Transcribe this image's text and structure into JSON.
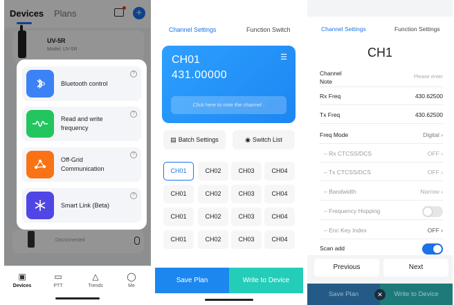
{
  "devices_screen": {
    "tab_devices": "Devices",
    "tab_plans": "Plans",
    "device_name": "UV-5R",
    "device_model": "Model: UV-5R",
    "disconnected": "Disconnected",
    "popup_items": [
      {
        "label": "Bluetooth control",
        "icon": "bluetooth-icon",
        "color": "#3b82f6"
      },
      {
        "label": "Read and write frequency",
        "icon": "waveform-icon",
        "color": "#22c55e"
      },
      {
        "label": "Off-Grid Communication",
        "icon": "network-icon",
        "color": "#f97316"
      },
      {
        "label": "Smart Link (Beta)",
        "icon": "smartlink-icon",
        "color": "#4f46e5"
      }
    ],
    "nav": [
      {
        "label": "Devices",
        "icon": "devices-icon"
      },
      {
        "label": "PTT",
        "icon": "ptt-icon"
      },
      {
        "label": "Trends",
        "icon": "trends-icon"
      },
      {
        "label": "Me",
        "icon": "me-icon"
      }
    ]
  },
  "channel_screen": {
    "tab_channel_settings": "Channel Settings",
    "tab_function_switch": "Function Switch",
    "current_channel": "CH01",
    "current_frequency": "431.00000",
    "note_placeholder": "Click here to note the channel ·",
    "batch_settings": "Batch Settings",
    "switch_list": "Switch List",
    "channels": [
      [
        "CH01",
        "CH02",
        "CH03",
        "CH04"
      ],
      [
        "CH01",
        "CH02",
        "CH03",
        "CH04"
      ],
      [
        "CH01",
        "CH02",
        "CH03",
        "CH04"
      ],
      [
        "CH01",
        "CH02",
        "CH03",
        "CH04"
      ]
    ],
    "save_plan": "Save Plan",
    "write_to_device": "Write to Device",
    "accent": "#1a73e8"
  },
  "detail_screen": {
    "tab_channel_settings": "Channel Settings",
    "tab_function_settings": "Function Settings",
    "title": "CH1",
    "rows": {
      "channel_note_label": "Channel Note",
      "channel_note_placeholder": "Please enter",
      "rx_freq_label": "Rx Freq",
      "rx_freq_value": "430.62500",
      "tx_freq_label": "Tx Freq",
      "tx_freq_value": "430.62500",
      "freq_mode_label": "Freq Mode",
      "freq_mode_value": "Digital",
      "rx_ctcss_label": "Rx CTCSS/DCS",
      "rx_ctcss_value": "OFF",
      "tx_ctcss_label": "Tx CTCSS/DCS",
      "tx_ctcss_value": "OFF",
      "bandwidth_label": "Bandwidth",
      "bandwidth_value": "Narrow",
      "freq_hopping_label": "Frequency Hopping",
      "enc_key_label": "Enc Key Index",
      "enc_key_value": "OFF",
      "scan_add_label": "Scan add"
    },
    "previous": "Previous",
    "next": "Next",
    "save_plan": "Save Plan",
    "write_to_device": "Write to Device"
  }
}
